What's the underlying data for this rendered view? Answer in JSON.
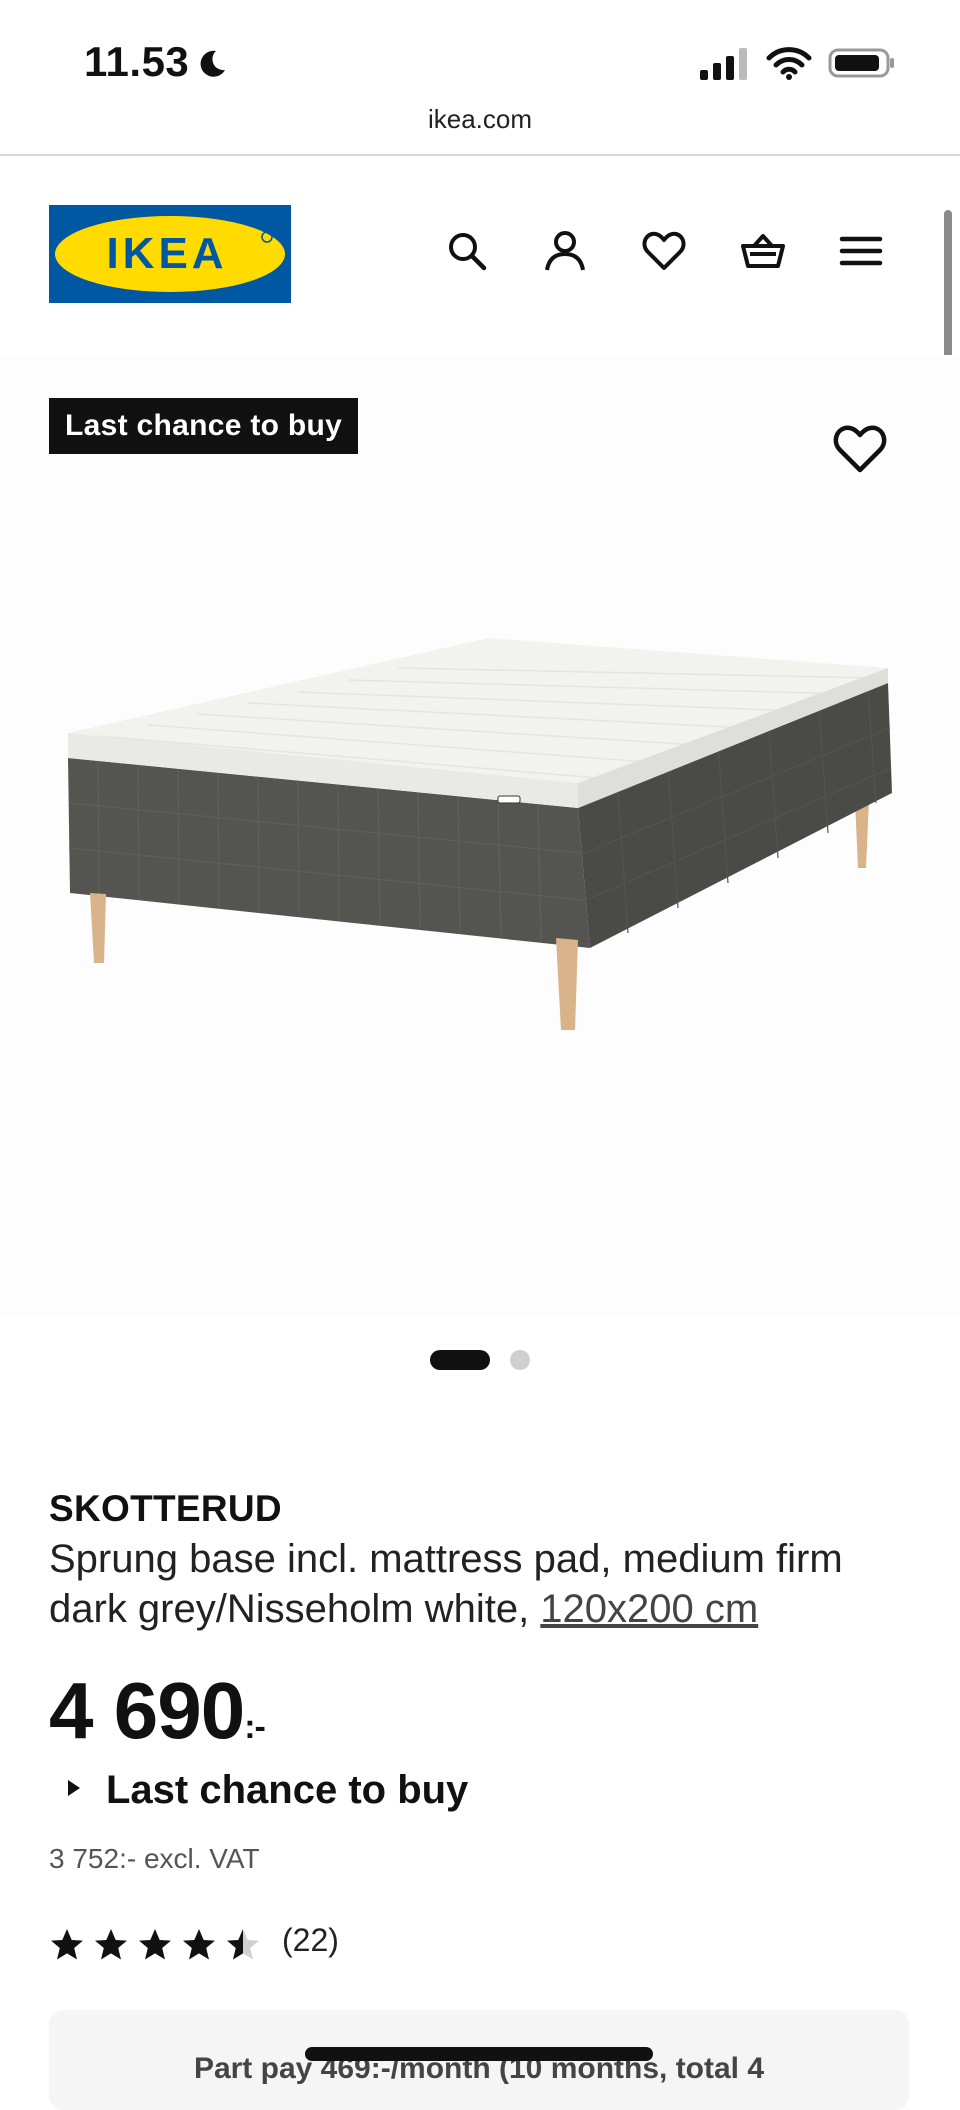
{
  "status_bar": {
    "time": "11.53",
    "icons": [
      "moon-icon",
      "signal-icon",
      "wifi-icon",
      "battery-icon"
    ]
  },
  "browser": {
    "url": "ikea.com"
  },
  "header": {
    "logo_text": "IKEA",
    "icons": [
      "search-icon",
      "user-icon",
      "heart-icon",
      "basket-icon",
      "menu-icon"
    ],
    "colors": {
      "logo_blue": "#0058A3",
      "logo_yellow": "#FFDB00"
    }
  },
  "gallery": {
    "badge": "Last chance to buy",
    "image_count": 2,
    "active_index": 0
  },
  "product": {
    "name": "SKOTTERUD",
    "description": "Sprung base incl. mattress pad, medium firm dark grey/Nisseholm white, ",
    "size": "120x200 cm",
    "price": "4 690",
    "price_suffix": ":-",
    "availability": "Last chance to buy",
    "excl_vat": "3 752:- excl. VAT",
    "rating": 4.5,
    "rating_max": 5,
    "reviews": "(22)"
  },
  "part_pay": {
    "text": "Part pay 469:-/month (10 months, total 4"
  }
}
